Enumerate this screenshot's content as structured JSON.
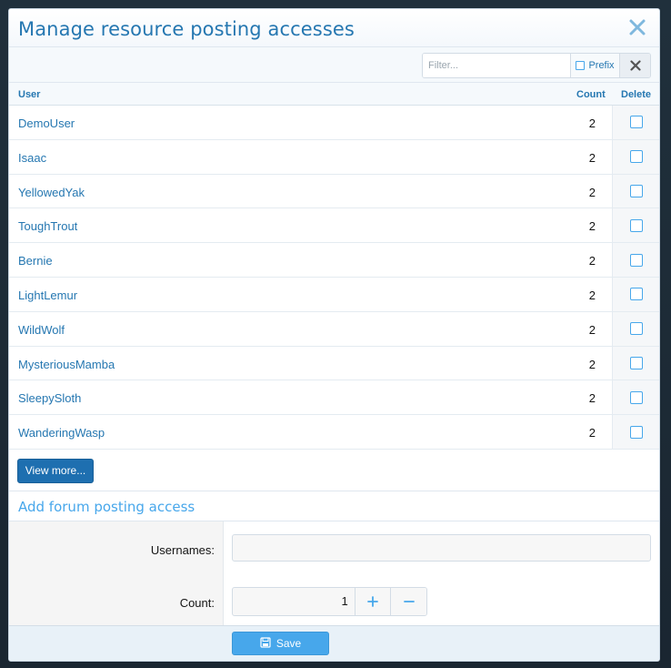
{
  "dialog": {
    "title": "Manage resource posting accesses"
  },
  "filter": {
    "placeholder": "Filter...",
    "prefix_label": "Prefix"
  },
  "table": {
    "headers": {
      "user": "User",
      "count": "Count",
      "delete": "Delete"
    },
    "rows": [
      {
        "user": "DemoUser",
        "count": "2"
      },
      {
        "user": "Isaac",
        "count": "2"
      },
      {
        "user": "YellowedYak",
        "count": "2"
      },
      {
        "user": "ToughTrout",
        "count": "2"
      },
      {
        "user": "Bernie",
        "count": "2"
      },
      {
        "user": "LightLemur",
        "count": "2"
      },
      {
        "user": "WildWolf",
        "count": "2"
      },
      {
        "user": "MysteriousMamba",
        "count": "2"
      },
      {
        "user": "SleepySloth",
        "count": "2"
      },
      {
        "user": "WanderingWasp",
        "count": "2"
      }
    ]
  },
  "view_more_label": "View more...",
  "add_section": {
    "title": "Add forum posting access",
    "usernames_label": "Usernames:",
    "count_label": "Count:",
    "count_value": "1",
    "save_label": "Save"
  },
  "colors": {
    "accent": "#2577b1",
    "link": "#47a7eb",
    "primary_button": "#1e6fb0"
  },
  "icons": {
    "close": "close-icon",
    "clear": "clear-icon",
    "plus": "plus-icon",
    "minus": "minus-icon",
    "save": "save-icon"
  }
}
